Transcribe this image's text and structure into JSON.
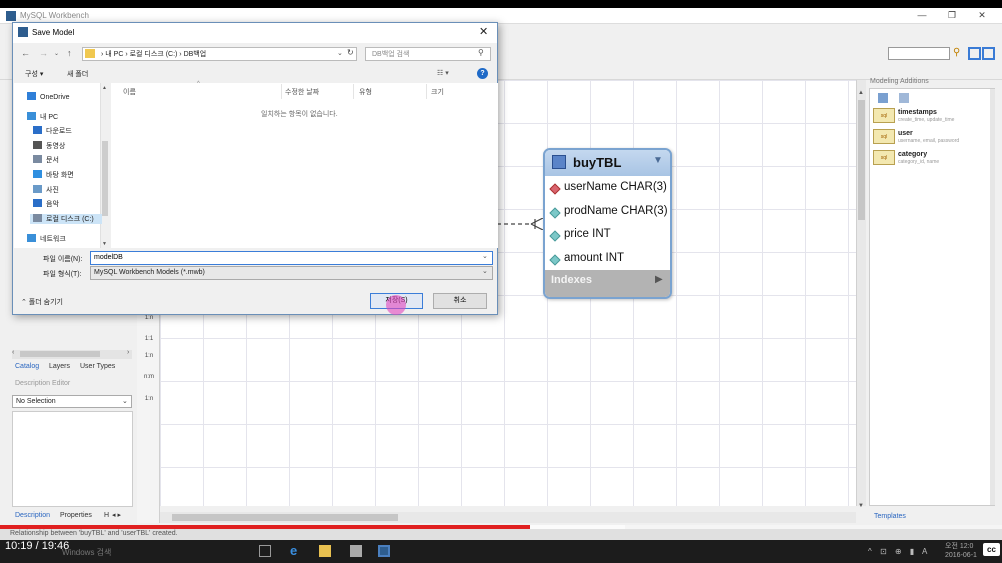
{
  "app": {
    "title": "MySQL Workbench"
  },
  "video": {
    "time": "10:19 / 19:46",
    "progress": 0.529
  },
  "status_bar": {
    "text": "Relationship between 'buyTBL' and 'userTBL' created."
  },
  "left_panel": {
    "tabs": [
      "Catalog",
      "Layers",
      "User Types"
    ],
    "description_editor": "Description Editor",
    "selection": "No Selection",
    "bottom_tabs": [
      "Description",
      "Properties",
      "H"
    ]
  },
  "palette": {
    "labels": [
      "1:n",
      "1:1",
      "1:n",
      "n:m",
      "1:n"
    ]
  },
  "right_panel": {
    "title": "Modeling Additions",
    "snippets": [
      {
        "name": "timestamps",
        "sub": "create_time, update_time"
      },
      {
        "name": "user",
        "sub": "username, email, password"
      },
      {
        "name": "category",
        "sub": "category_id, name"
      }
    ],
    "templates_tab": "Templates"
  },
  "table": {
    "name": "buyTBL",
    "columns": [
      {
        "label": "userName CHAR(3)",
        "key": true
      },
      {
        "label": "prodName CHAR(3)",
        "key": false
      },
      {
        "label": "price INT",
        "key": false
      },
      {
        "label": "amount INT",
        "key": false
      }
    ],
    "indexes_label": "Indexes"
  },
  "dialog": {
    "title": "Save Model",
    "address": "› 내 PC › 로컬 디스크 (C:) › DB백업",
    "search_placeholder": "DB백업 검색",
    "organize": "구성 ▾",
    "new_folder": "새 폴더",
    "nav_items": [
      {
        "label": "OneDrive",
        "icon": "cloud-icon",
        "color": "#2f7fd8"
      },
      {
        "label": "내 PC",
        "icon": "pc-icon",
        "color": "#3a8fd8"
      },
      {
        "label": "다운로드",
        "icon": "download-icon",
        "color": "#2a6ec8"
      },
      {
        "label": "동영상",
        "icon": "video-icon",
        "color": "#555555"
      },
      {
        "label": "문서",
        "icon": "document-icon",
        "color": "#7a8aa0"
      },
      {
        "label": "바탕 화면",
        "icon": "desktop-icon",
        "color": "#2f8fe0"
      },
      {
        "label": "사진",
        "icon": "picture-icon",
        "color": "#6a9ac8"
      },
      {
        "label": "음악",
        "icon": "music-icon",
        "color": "#2a6ec8"
      },
      {
        "label": "로컬 디스크 (C:)",
        "icon": "disk-icon",
        "color": "#7a8aa0"
      },
      {
        "label": "네트워크",
        "icon": "network-icon",
        "color": "#3a8fd8"
      }
    ],
    "columns": [
      "이름",
      "수정한 날짜",
      "유형",
      "크기"
    ],
    "empty_message": "일치하는 항목이 없습니다.",
    "file_name_label": "파일 이름(N):",
    "file_name_value": "modelDB",
    "file_type_label": "파일 형식(T):",
    "file_type_value": "MySQL Workbench Models (*.mwb)",
    "hide_folders": "⌃ 폴더 숨기기",
    "save_label": "저장(S)",
    "cancel_label": "취소"
  },
  "taskbar": {
    "search_text": "Windows 검색",
    "clock_time": "오전 12:0",
    "clock_date": "2016-06-1"
  }
}
